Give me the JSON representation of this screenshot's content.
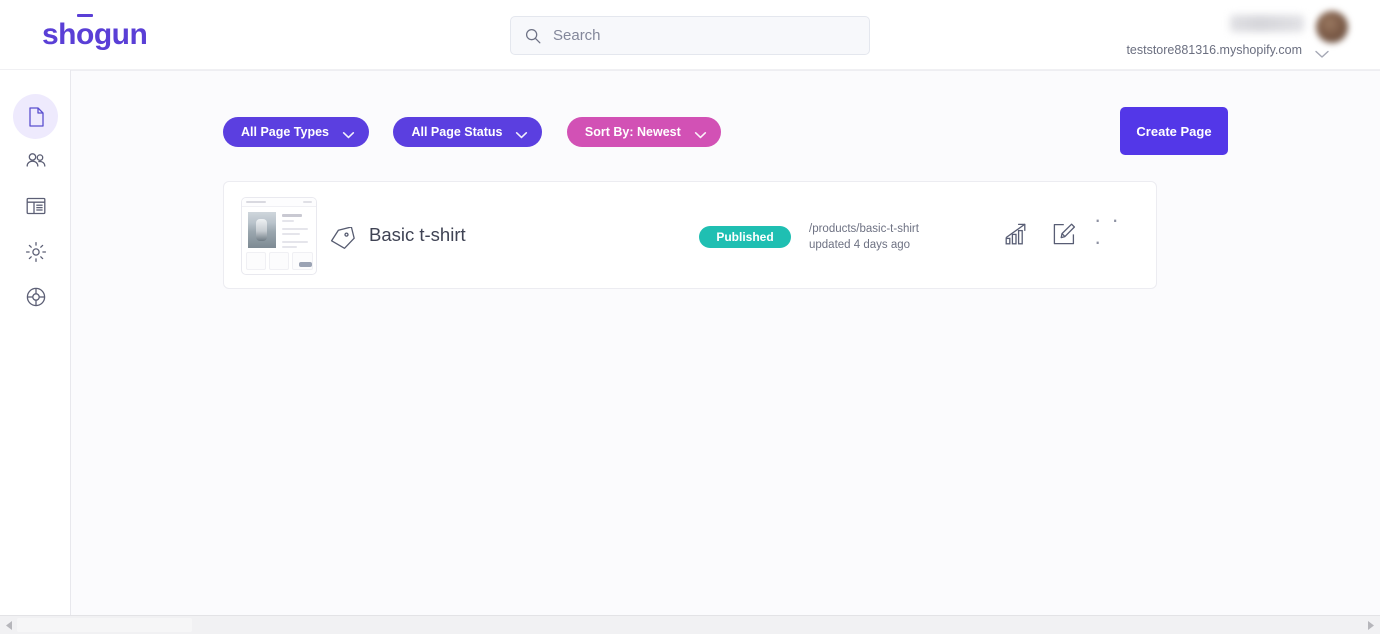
{
  "header": {
    "logo_text": "shogun",
    "logo_part_a": "sh",
    "logo_part_b": "o",
    "logo_part_c": "gun",
    "search": {
      "placeholder": "Search",
      "value": "",
      "icon": "search-icon"
    },
    "account": {
      "store_url": "teststore881316.myshopify.com",
      "user_name": "",
      "chevron_icon": "chevron-down-icon",
      "avatar_icon": "avatar"
    }
  },
  "sidebar": {
    "items": [
      {
        "name": "pages",
        "icon": "page-icon",
        "active": true,
        "label": "Pages"
      },
      {
        "name": "team",
        "icon": "users-icon",
        "active": false,
        "label": "Team"
      },
      {
        "name": "templates",
        "icon": "layout-icon",
        "active": false,
        "label": "Templates"
      },
      {
        "name": "settings",
        "icon": "gear-icon",
        "active": false,
        "label": "Settings"
      },
      {
        "name": "help",
        "icon": "lifebuoy-icon",
        "active": false,
        "label": "Help"
      }
    ]
  },
  "toolbar": {
    "filters": [
      {
        "label": "All Page Types",
        "color": "#5b3fe0",
        "icon": "chevron-down-icon"
      },
      {
        "label": "All Page Status",
        "color": "#5b3fe0",
        "icon": "chevron-down-icon"
      },
      {
        "label": "Sort By: Newest",
        "color": "#d251b5",
        "icon": "chevron-down-icon"
      }
    ],
    "create_label": "Create Page"
  },
  "page_list": {
    "items": [
      {
        "title": "Basic t-shirt",
        "type_icon": "tag-icon",
        "status": "Published",
        "status_color": "#1fbfb2",
        "url_path": "/products/basic-t-shirt",
        "updated": "updated 4 days ago",
        "actions": {
          "analytics": "analytics-icon",
          "edit": "edit-icon",
          "more": "· · ·"
        }
      }
    ]
  },
  "scrollbar": {
    "left_arrow": "scroll-left-arrow",
    "right_arrow": "scroll-right-arrow"
  },
  "colors": {
    "brand_purple": "#5A3FD6",
    "button_purple": "#5337e8",
    "pill_purple": "#5b3fe0",
    "pill_pink": "#d251b5",
    "status_teal": "#1fbfb2",
    "page_bg": "#fbfbfd"
  }
}
